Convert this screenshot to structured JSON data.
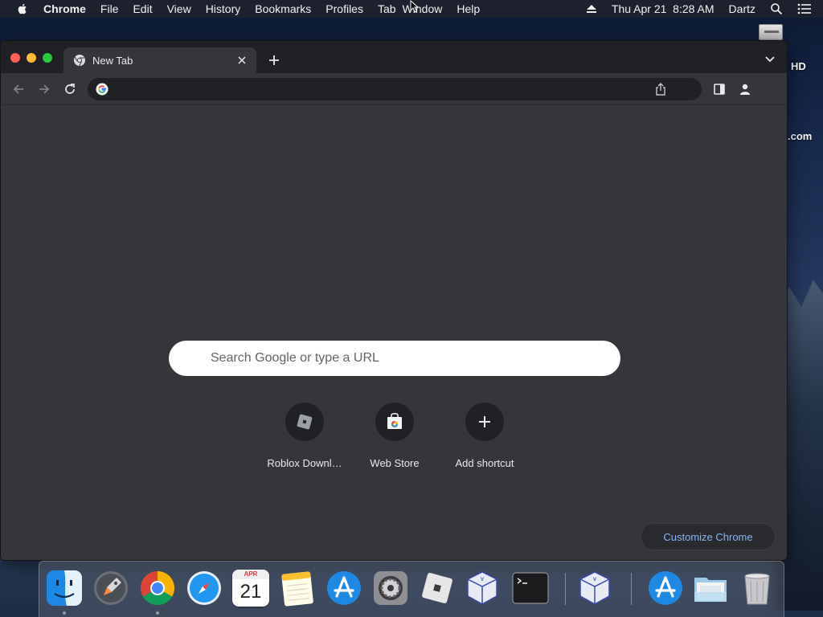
{
  "menubar": {
    "app": "Chrome",
    "items": [
      "File",
      "Edit",
      "View",
      "History",
      "Bookmarks",
      "Profiles",
      "Tab",
      "Window",
      "Help"
    ],
    "datetime": "Thu Apr 21  8:28 AM",
    "user": "Dartz"
  },
  "desktop": {
    "label1": "HD",
    "label2": ".com"
  },
  "tab": {
    "title": "New Tab"
  },
  "omnibox": {
    "value": "",
    "placeholder": ""
  },
  "ntp": {
    "search_placeholder": "Search Google or type a URL",
    "shortcuts": [
      {
        "label": "Roblox Downl…",
        "icon": "roblox-icon"
      },
      {
        "label": "Web Store",
        "icon": "web-store-icon"
      },
      {
        "label": "Add shortcut",
        "icon": "plus-icon"
      }
    ],
    "customize_label": "Customize Chrome"
  },
  "dock": {
    "items": [
      "finder-icon",
      "launchpad-icon",
      "chrome-icon",
      "safari-icon",
      "calendar-icon",
      "notes-icon",
      "app-store-icon",
      "system-preferences-icon",
      "roblox-icon",
      "virtualbox-icon",
      "terminal-icon",
      "virtualbox-icon",
      "app-store-icon",
      "downloads-folder-icon",
      "trash-icon"
    ],
    "calendar_month": "APR",
    "calendar_day": "21"
  },
  "colors": {
    "accent": "#8ab4f8",
    "window_bg": "#35363a",
    "tabstrip_bg": "#202124"
  }
}
